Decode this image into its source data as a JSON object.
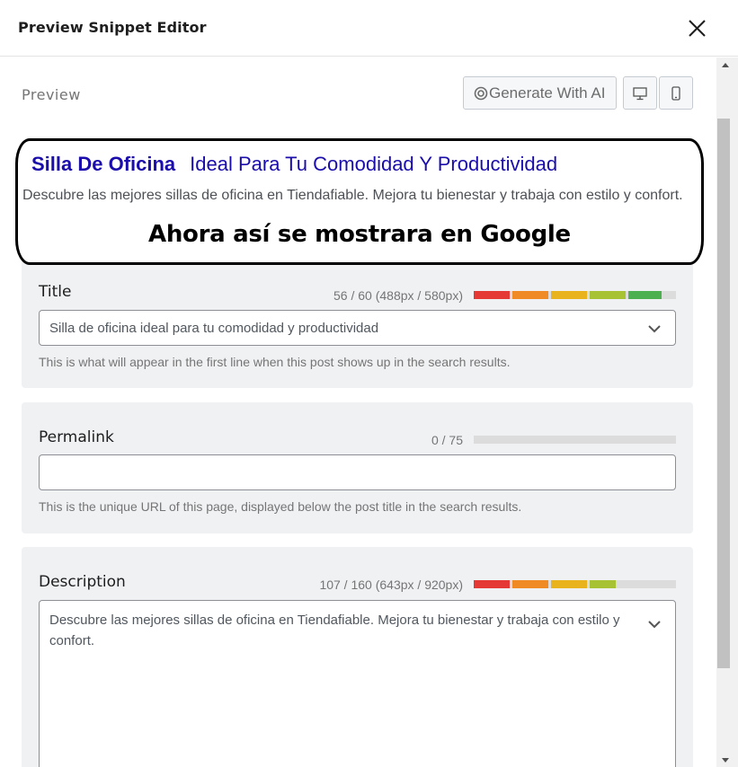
{
  "header": {
    "title": "Preview Snippet Editor"
  },
  "preview": {
    "label": "Preview",
    "ai_button_label": "Generate With AI",
    "ai_icon": "ai-swirl-icon",
    "desktop_icon": "desktop-icon",
    "mobile_icon": "mobile-icon"
  },
  "snippet": {
    "title_bold": "Silla De Oficina",
    "title_rest": "Ideal Para Tu Comodidad Y Productividad",
    "description": "Descubre las mejores sillas de oficina en Tiendafiable. Mejora tu bienestar y trabaja con estilo y confort.",
    "annotation": "Ahora así se mostrara en Google"
  },
  "fields": {
    "title": {
      "label": "Title",
      "counter": "56 / 60 (488px / 580px)",
      "value": "Silla de oficina ideal para tu comodidad y productividad",
      "help": "This is what will appear in the first line when this post shows up in the search results.",
      "progress": 0.93
    },
    "permalink": {
      "label": "Permalink",
      "counter": "0 / 75",
      "value": "",
      "help": "This is the unique URL of this page, displayed below the post title in the search results.",
      "progress": 0
    },
    "description": {
      "label": "Description",
      "counter": "107 / 160 (643px / 920px)",
      "value": "Descubre las mejores sillas de oficina en Tiendafiable. Mejora tu bienestar y trabaja con estilo y confort.",
      "progress": 0.7
    }
  },
  "colors": {
    "meter_red": "#e53935",
    "meter_orange": "#f08a24",
    "meter_yellow": "#e8b31c",
    "meter_lime": "#a7c232",
    "meter_green": "#4caf50",
    "meter_track": "#dcdcdc",
    "snippet_title": "#1a0dab"
  }
}
